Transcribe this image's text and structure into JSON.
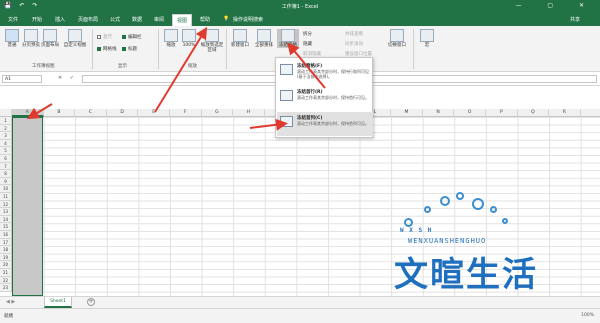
{
  "window": {
    "title": "工作簿1 - Excel",
    "controls": [
      "—",
      "▢",
      "✕"
    ]
  },
  "tabs": [
    "文件",
    "开始",
    "插入",
    "页面布局",
    "公式",
    "数据",
    "审阅",
    "视图",
    "帮助"
  ],
  "tab_extra": "操作说明搜索",
  "share_label": "共享",
  "active_tab": "视图",
  "ribbon": {
    "views": {
      "normal": "普通",
      "pagebreak": "分页预览",
      "pagelayout": "页面布局",
      "custom": "自定义视图",
      "group": "工作簿视图"
    },
    "show": {
      "ruler": "直尺",
      "formula_bar": "编辑栏",
      "gridlines": "网格线",
      "headings": "标题",
      "group": "显示"
    },
    "zoom": {
      "zoom": "缩放",
      "hundred": "100%",
      "zoom_sel": "缩放到选定区域",
      "group": "缩放"
    },
    "window": {
      "new_window": "新建窗口",
      "arrange_all": "全部重排",
      "freeze": "冻结窗格",
      "split": "拆分",
      "hide": "隐藏",
      "unhide": "取消隐藏",
      "side_by_side": "并排查看",
      "sync_scroll": "同步滚动",
      "reset_pos": "重设窗口位置",
      "switch": "切换窗口",
      "macro": "宏"
    }
  },
  "formula_bar": {
    "namebox": "A1",
    "fx": "✕ ✓ fx"
  },
  "dropdown": [
    {
      "title": "冻结窗格(F)",
      "desc": "滚动工作表其余部分时，保持行和列可见(基于当前的选择)。"
    },
    {
      "title": "冻结首行(R)",
      "desc": "滚动工作表其余部分时，保持首行可见。"
    },
    {
      "title": "冻结首列(C)",
      "desc": "滚动工作表其余部分时，保持首列可见。"
    }
  ],
  "columns": [
    "A",
    "B",
    "C",
    "D",
    "E",
    "F",
    "G",
    "H",
    "I",
    "J",
    "K",
    "L",
    "M",
    "N",
    "O",
    "P",
    "Q",
    "R"
  ],
  "rows": [
    "1",
    "2",
    "3",
    "4",
    "5",
    "6",
    "7",
    "8",
    "9",
    "10",
    "11",
    "12",
    "13",
    "14",
    "15",
    "16",
    "17",
    "18",
    "19",
    "20",
    "21",
    "22",
    "23"
  ],
  "sheet_tab": "Sheet1",
  "add_sheet": "+",
  "status": "就绪",
  "zoom_level": "100%",
  "logo": {
    "en_small": "W X S H",
    "en": "WENXUANSHENGHUO",
    "cn": "文暄生活"
  },
  "colors": {
    "accent": "#217346",
    "arrow": "#e03a2f",
    "logo": "#1f6fbf"
  }
}
